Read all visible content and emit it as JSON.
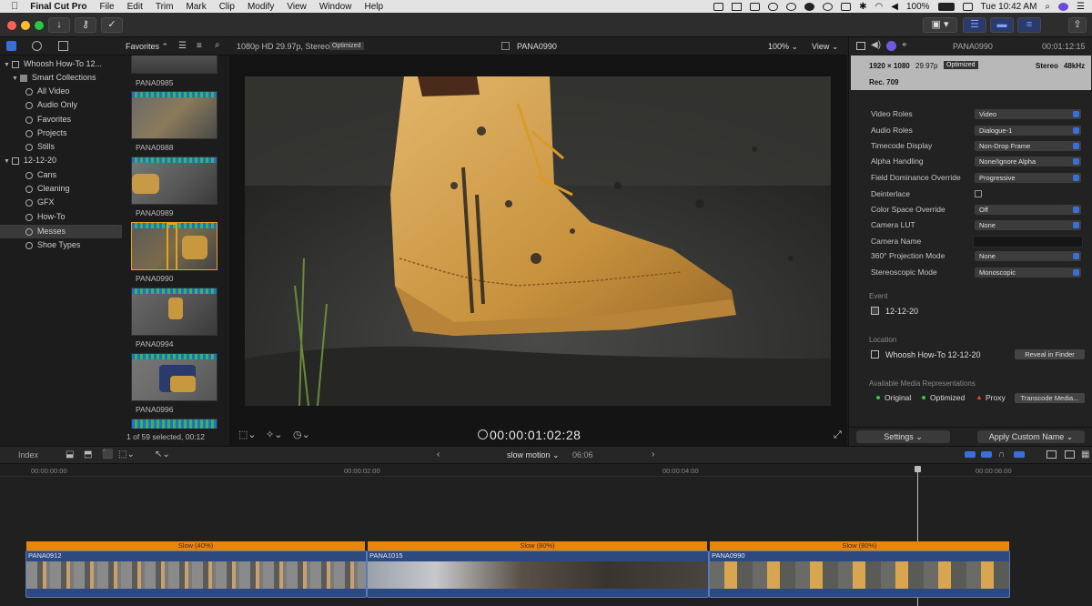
{
  "menubar": {
    "app_name": "Final Cut Pro",
    "items": [
      "File",
      "Edit",
      "Trim",
      "Mark",
      "Clip",
      "Modify",
      "View",
      "Window",
      "Help"
    ],
    "battery": "100%",
    "clock": "Tue 10:42 AM"
  },
  "browser": {
    "filter_label": "Favorites",
    "format_info": "1080p HD 29.97p, Stereo",
    "optimized_badge": "Optimized",
    "clip_title": "PANA0990",
    "zoom": "100%",
    "view_label": "View",
    "selection_status": "1 of 59 selected, 00:12"
  },
  "sidebar": {
    "library": "Whoosh How-To 12...",
    "items": [
      {
        "label": "Smart Collections"
      },
      {
        "label": "All Video"
      },
      {
        "label": "Audio Only"
      },
      {
        "label": "Favorites"
      },
      {
        "label": "Projects"
      },
      {
        "label": "Stills"
      },
      {
        "label": "12-12-20"
      },
      {
        "label": "Cans"
      },
      {
        "label": "Cleaning"
      },
      {
        "label": "GFX"
      },
      {
        "label": "How-To"
      },
      {
        "label": "Messes"
      },
      {
        "label": "Shoe Types"
      }
    ]
  },
  "filmstrip": {
    "clips": [
      "PANA0985",
      "PANA0988",
      "PANA0989",
      "PANA0990",
      "PANA0994",
      "PANA0996"
    ]
  },
  "viewer": {
    "timecode": "00:00:01:02:28"
  },
  "inspector": {
    "clip_name": "PANA0990",
    "duration": "00:01:12:15",
    "resolution": "1920 × 1080",
    "framerate": "29.97p",
    "optimized": "Optimized",
    "audio": "Stereo",
    "samplerate": "48kHz",
    "colorspace": "Rec. 709",
    "rows": [
      {
        "label": "Video Roles",
        "value": "Video"
      },
      {
        "label": "Audio Roles",
        "value": "Dialogue-1"
      },
      {
        "label": "Timecode Display",
        "value": "Non-Drop Frame"
      },
      {
        "label": "Alpha Handling",
        "value": "None/Ignore Alpha"
      },
      {
        "label": "Field Dominance Override",
        "value": "Progressive"
      },
      {
        "label": "Deinterlace",
        "value": ""
      },
      {
        "label": "Color Space Override",
        "value": "Off"
      },
      {
        "label": "Camera LUT",
        "value": "None"
      },
      {
        "label": "Camera Name",
        "value": ""
      },
      {
        "label": "360° Projection Mode",
        "value": "None"
      },
      {
        "label": "Stereoscopic Mode",
        "value": "Monoscopic"
      }
    ],
    "event_heading": "Event",
    "event_value": "12-12-20",
    "location_heading": "Location",
    "location_value": "Whoosh How-To 12-12-20",
    "reveal_button": "Reveal in Finder",
    "media_heading": "Available Media Representations",
    "rep_original": "Original",
    "rep_optimized": "Optimized",
    "rep_proxy": "Proxy",
    "transcode_button": "Transcode Media...",
    "settings_button": "Settings",
    "apply_button": "Apply Custom Name"
  },
  "timeline": {
    "index_label": "Index",
    "project_name": "slow motion",
    "project_duration": "06:06",
    "ruler": [
      "00:00:00:00",
      "00:00:02:00",
      "00:00:04:00",
      "00:00:06:00"
    ],
    "clips": [
      {
        "name": "PANA0912",
        "retime": "Slow (40%)"
      },
      {
        "name": "PANA1015",
        "retime": "Slow (80%)"
      },
      {
        "name": "PANA0990",
        "retime": "Slow (80%)"
      }
    ]
  }
}
